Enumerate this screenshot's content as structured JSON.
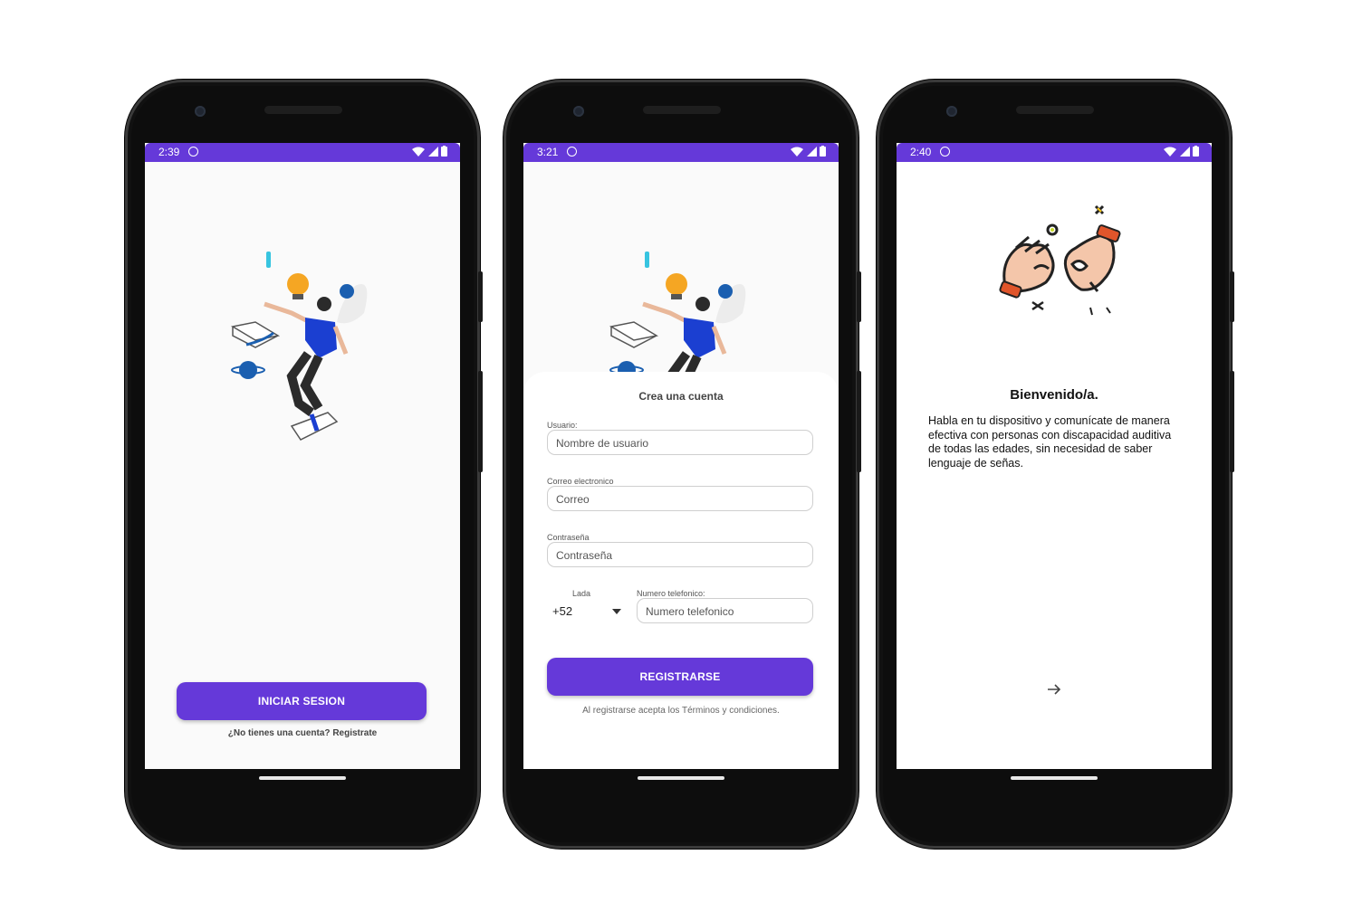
{
  "screens": [
    {
      "status": {
        "time": "2:39"
      },
      "login_button": "INICIAR SESION",
      "signup_link": "¿No tienes una cuenta? Registrate"
    },
    {
      "status": {
        "time": "3:21"
      },
      "form_title": "Crea una cuenta",
      "fields": {
        "username": {
          "label": "Usuario:",
          "placeholder": "Nombre de usuario"
        },
        "email": {
          "label": "Correo electronico",
          "placeholder": "Correo"
        },
        "password": {
          "label": "Contraseña",
          "placeholder": "Contraseña"
        },
        "lada": {
          "label": "Lada",
          "value": "+52"
        },
        "phone": {
          "label": "Numero telefonico:",
          "placeholder": "Numero telefonico"
        }
      },
      "register_button": "REGISTRARSE",
      "terms": "Al registrarse acepta los Términos y condiciones."
    },
    {
      "status": {
        "time": "2:40"
      },
      "welcome_title": "Bienvenido/a.",
      "welcome_body": "Habla en tu dispositivo y comunícate de manera efectiva con personas con discapacidad auditiva de todas las edades, sin necesidad de saber lenguaje de señas."
    }
  ],
  "icons": [
    "wifi-icon",
    "signal-icon",
    "battery-icon",
    "dnd-icon",
    "dropdown-arrow-icon",
    "arrow-right-icon"
  ],
  "colors": {
    "accent": "#6539d9",
    "status_bar": "#6539d9",
    "illustration_blue": "#1b3fd1",
    "illustration_orange": "#f5a623",
    "hand_orange": "#e0552b"
  }
}
